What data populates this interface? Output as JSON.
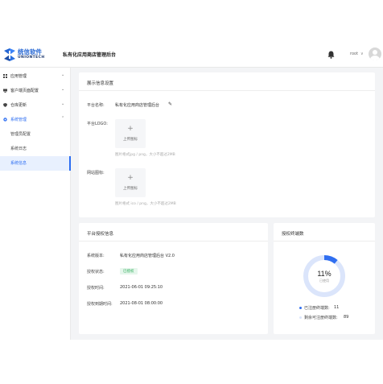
{
  "brand": {
    "name_cn": "统信软件",
    "name_en": "UNIONTECH"
  },
  "header": {
    "title": "私有化应用商店管理后台",
    "user_name": "root",
    "user_caret": "∨"
  },
  "sidebar": {
    "menu": [
      {
        "label": "应用管理",
        "icon": "grid-icon"
      },
      {
        "label": "客户端页面配置",
        "icon": "monitor-icon"
      },
      {
        "label": "仓库更新",
        "icon": "shield-icon"
      },
      {
        "label": "系统管理",
        "icon": "gear-icon"
      }
    ],
    "submenu": [
      {
        "label": "管理员配置"
      },
      {
        "label": "系统日志"
      },
      {
        "label": "系统信息"
      }
    ],
    "arrow_down": "⌄",
    "arrow_up": "⌃"
  },
  "display_settings": {
    "title": "展示信息设置",
    "platform_name_label": "平台名称:",
    "platform_name_value": "私有化应用商店管理后台",
    "edit_icon": "✎",
    "logo_label": "平台LOGO:",
    "upload_plus": "+",
    "upload_text": "上传图标",
    "logo_hint": "图片格式jpg / png，大小不超过2MB",
    "favicon_label": "网站图标:",
    "favicon_hint": "图片格式 ico / png，大小不超过2MB"
  },
  "license": {
    "title": "平台授权信息",
    "version_label": "系统版本:",
    "version_value": "私有化应用商店管理后台 V2.0",
    "status_label": "授权状态:",
    "status_value": "已授权",
    "auth_time_label": "授权时间:",
    "auth_time_value": "2021-06-01 09:25:10",
    "expire_label": "授权到期时间:",
    "expire_value": "2021-08-01 08:00:00"
  },
  "terminals": {
    "title": "授权终端数",
    "percent": "11%",
    "percent_value": 0.11,
    "center_label": "已使用",
    "registered_label": "已注册终端数:",
    "registered_value": "11",
    "remaining_label": "剩余可注册终端数:",
    "remaining_value": "89"
  },
  "colors": {
    "accent": "#2c6df2",
    "ring_used": "#2f6ef0",
    "ring_rest": "#dbe5fb",
    "success": "#2fae5b"
  }
}
